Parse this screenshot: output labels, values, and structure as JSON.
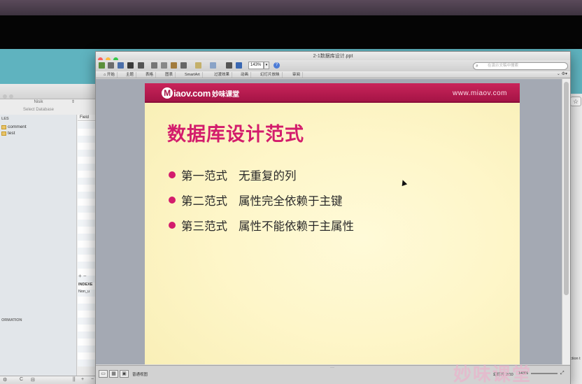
{
  "background_window": {
    "db_selector": "Nisik",
    "db_placeholder": "Select Database",
    "tables_section": "LES",
    "tables": [
      "comment",
      "test"
    ],
    "content_header": "Field",
    "indexes_label": "INDEXE",
    "index_row": "Non_u",
    "info_section": "ORMATION",
    "bottom_buttons": [
      "⚙",
      "C",
      "⊟",
      "||",
      "+",
      "−",
      "C"
    ]
  },
  "right_window": {
    "star_glyph": "☆",
    "fragment_text": "ction t"
  },
  "powerpoint": {
    "title": "2-1数据库设计.ppt",
    "zoom": "143%",
    "search_placeholder": "在演示文稿中搜索",
    "ribbon_tabs": [
      "开始",
      "主题",
      "表格",
      "图表",
      "SmartArt",
      "过渡效果",
      "动画",
      "幻灯片放映",
      "审阅"
    ],
    "status": {
      "mode": "普通视图",
      "slide_number": "幻灯片 2/10",
      "zoom": "143%"
    },
    "slide": {
      "logo_latin": "iaov.com",
      "logo_m": "M",
      "logo_cn": "妙味课堂",
      "url": "www.miaov.com",
      "title": "数据库设计范式",
      "bullets": [
        {
          "label": "第一范式",
          "text": "无重复的列"
        },
        {
          "label": "第二范式",
          "text": "属性完全依赖于主键"
        },
        {
          "label": "第三范式",
          "text": "属性不能依赖于主属性"
        }
      ],
      "accent_color": "#d31c6c",
      "banner_color": "#a51446"
    }
  },
  "watermark": "妙味课堂"
}
